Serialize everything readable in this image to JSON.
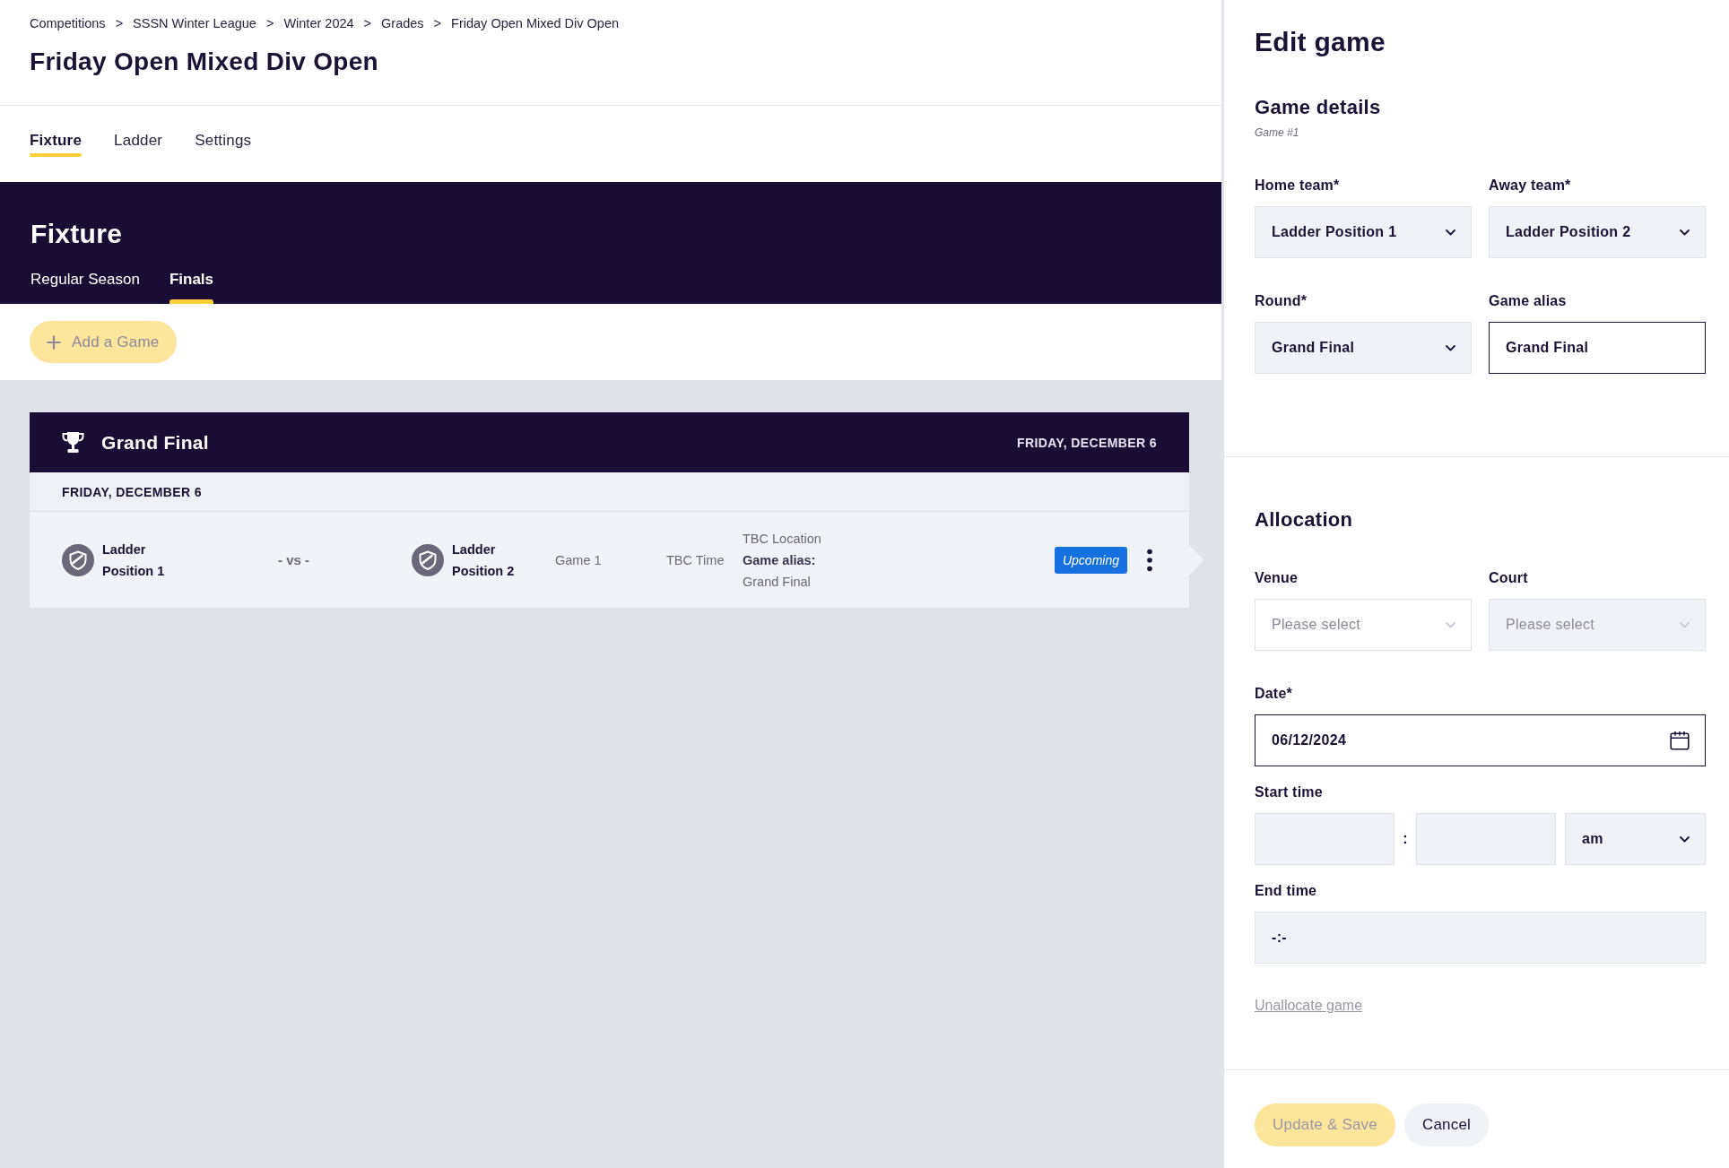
{
  "breadcrumb": [
    {
      "label": "Competitions",
      "separator": ">"
    },
    {
      "label": "SSSN Winter League",
      "separator": ">"
    },
    {
      "label": "Winter 2024",
      "separator": ">"
    },
    {
      "label": "Grades",
      "separator": ">"
    },
    {
      "label": "Friday Open Mixed Div Open"
    }
  ],
  "page_title": "Friday Open Mixed Div Open",
  "tabs": [
    {
      "label": "Fixture",
      "selected": true
    },
    {
      "label": "Ladder",
      "selected": false
    },
    {
      "label": "Settings",
      "selected": false
    }
  ],
  "fixture": {
    "title": "Fixture",
    "tabs": [
      {
        "label": "Regular Season",
        "selected": false
      },
      {
        "label": "Finals",
        "selected": true
      }
    ],
    "add_button": {
      "label": "Add a Game",
      "disabled": true
    },
    "rounds": [
      {
        "title": "Grand Final",
        "date": "FRIDAY, DECEMBER 6",
        "days": [
          {
            "date": "FRIDAY, DECEMBER 6",
            "games": [
              {
                "home_team": "Ladder Position 1",
                "versus": "- vs -",
                "away_team": "Ladder Position 2",
                "game": "Game 1",
                "time": "TBC Time",
                "location": "TBC Location",
                "alias_label": "Game alias:",
                "alias": "Grand Final",
                "status": "Upcoming",
                "selected": true
              }
            ]
          }
        ]
      }
    ]
  },
  "edit_panel": {
    "title": "Edit game",
    "sections": [
      {
        "title": "Game details",
        "subtitle": "Game #1",
        "rows": [
          [
            {
              "kind": "select",
              "label": "Home team*",
              "value": "Ladder Position 1",
              "disabled": false
            },
            {
              "kind": "select",
              "label": "Away team*",
              "value": "Ladder Position 2",
              "disabled": false
            }
          ],
          [
            {
              "kind": "select",
              "label": "Round*",
              "value": "Grand Final",
              "disabled": false
            },
            {
              "kind": "text",
              "label": "Game alias",
              "value": "Grand Final",
              "disabled": false
            }
          ]
        ]
      },
      {
        "title": "Allocation",
        "rows": [
          [
            {
              "kind": "select",
              "label": "Venue",
              "placeholder": "Please select",
              "disabled": false
            },
            {
              "kind": "select",
              "label": "Court",
              "placeholder": "Please select",
              "disabled": true
            }
          ],
          [
            {
              "kind": "date",
              "label": "Date*",
              "value": "06/12/2024",
              "disabled": false
            }
          ],
          [
            {
              "kind": "time",
              "label": "Start time",
              "separator": ":",
              "period": "am",
              "disabled": false
            }
          ],
          [
            {
              "kind": "text",
              "label": "End time",
              "value": "-:-",
              "disabled": true
            }
          ]
        ],
        "link": "Unallocate game"
      }
    ],
    "actions": [
      {
        "kind": "primary",
        "label": "Update & Save",
        "disabled": true
      },
      {
        "kind": "secondary",
        "label": "Cancel",
        "disabled": false
      }
    ]
  }
}
